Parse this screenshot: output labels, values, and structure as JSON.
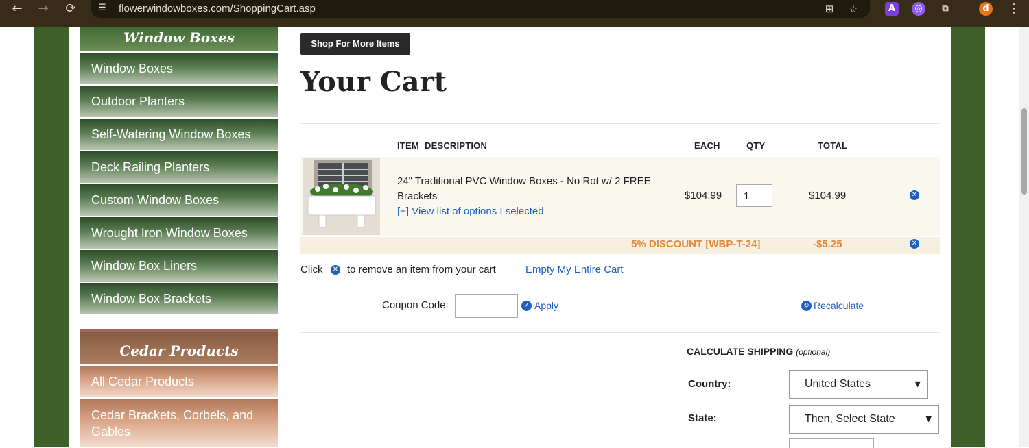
{
  "browser": {
    "url": "flowerwindowboxes.com/ShoppingCart.asp",
    "back": "←",
    "forward": "→",
    "reload": "⟳",
    "profile_initial": "d",
    "menu": "⋮"
  },
  "sidebar": {
    "section1_title": "Window Boxes",
    "section1_items": [
      "Window Boxes",
      "Outdoor Planters",
      "Self-Watering Window Boxes",
      "Deck Railing Planters",
      "Custom Window Boxes",
      "Wrought Iron Window Boxes",
      "Window Box Liners",
      "Window Box Brackets"
    ],
    "section2_title": "Cedar Products",
    "section2_items": [
      "All Cedar Products",
      "Cedar Brackets, Corbels, and Gables"
    ]
  },
  "cart": {
    "shop_more_label": "Shop For More Items",
    "title": "Your Cart",
    "headers": {
      "item": "ITEM",
      "description": "DESCRIPTION",
      "each": "EACH",
      "qty": "QTY",
      "total": "TOTAL"
    },
    "item": {
      "description": "24\" Traditional PVC Window Boxes - No Rot w/ 2 FREE Brackets",
      "options_link": "[+] View list of options I selected",
      "each": "$104.99",
      "qty": "1",
      "total": "$104.99"
    },
    "discount": {
      "label": "5% DISCOUNT [WBP-T-24]",
      "amount": "-$5.25"
    },
    "remove_hint_prefix": "Click",
    "remove_hint_suffix": "to remove an item from your cart",
    "empty_cart_link": "Empty My Entire Cart",
    "coupon_label": "Coupon Code:",
    "coupon_value": "",
    "apply_label": "Apply",
    "recalculate_label": "Recalculate"
  },
  "shipping": {
    "title": "CALCULATE SHIPPING",
    "title_note": "(optional)",
    "country_label": "Country:",
    "country_value": "United States",
    "state_label": "State:",
    "state_value": "Then, Select State"
  },
  "colors": {
    "page_green": "#3d5f29",
    "link_blue": "#1f5fbf",
    "discount_orange": "#e08a3a",
    "browser_chrome": "#362c18"
  }
}
